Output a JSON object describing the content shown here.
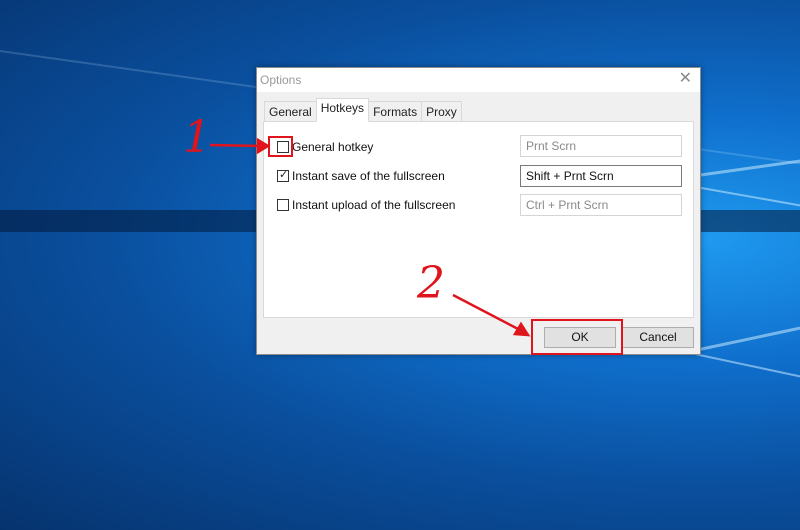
{
  "desktop": {
    "background_color": "#0a5bb8"
  },
  "dialog": {
    "title": "Options",
    "close_icon": "close-icon",
    "tabs": [
      {
        "label": "General",
        "active": false
      },
      {
        "label": "Hotkeys",
        "active": true
      },
      {
        "label": "Formats",
        "active": false
      },
      {
        "label": "Proxy",
        "active": false
      }
    ],
    "hotkeys": [
      {
        "label": "General hotkey",
        "checked": false,
        "value": "Prnt Scrn",
        "enabled": false
      },
      {
        "label": "Instant save of the fullscreen",
        "checked": true,
        "value": "Shift + Prnt Scrn",
        "enabled": true
      },
      {
        "label": "Instant upload of the fullscreen",
        "checked": false,
        "value": "Ctrl + Prnt Scrn",
        "enabled": false
      }
    ],
    "buttons": {
      "ok_label": "OK",
      "cancel_label": "Cancel"
    }
  },
  "annotations": {
    "step1": "1",
    "step2": "2",
    "color": "#e0141c"
  }
}
